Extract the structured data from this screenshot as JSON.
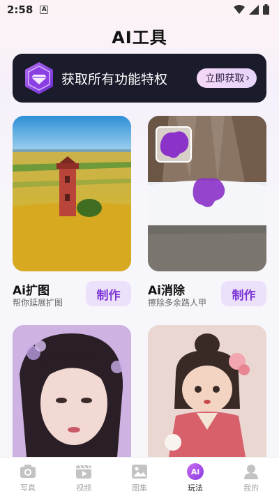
{
  "status": {
    "time": "2:58",
    "notif": "A"
  },
  "title": "AI工具",
  "promo": {
    "text": "获取所有功能特权",
    "button": "立即获取",
    "chevron": "›"
  },
  "cards": [
    {
      "title": "Ai扩图",
      "subtitle": "帮你延展扩图",
      "button": "制作"
    },
    {
      "title": "Ai消除",
      "subtitle": "擦除多余路人甲",
      "button": "制作"
    }
  ],
  "tabs": [
    {
      "label": "写真",
      "icon": "camera-icon",
      "active": false
    },
    {
      "label": "视频",
      "icon": "video-icon",
      "active": false
    },
    {
      "label": "图集",
      "icon": "gallery-icon",
      "active": false
    },
    {
      "label": "玩法",
      "icon": "ai-icon",
      "icon_text": "Ai",
      "active": true
    },
    {
      "label": "我的",
      "icon": "profile-icon",
      "active": false
    }
  ],
  "colors": {
    "accent": "#7b34d6",
    "banner": "#1a1b2b",
    "button_bg": "#ece1fb"
  }
}
